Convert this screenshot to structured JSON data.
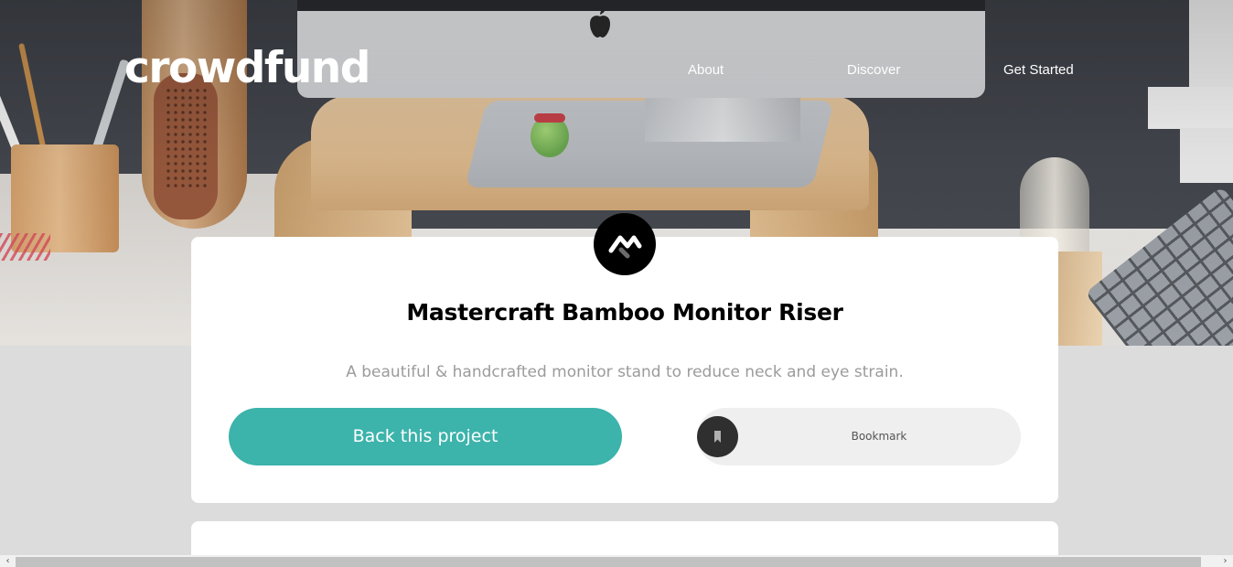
{
  "header": {
    "logo": "crowdfund",
    "nav": [
      {
        "label": "About"
      },
      {
        "label": "Discover"
      },
      {
        "label": "Get Started"
      }
    ]
  },
  "project": {
    "title": "Mastercraft Bamboo Monitor Riser",
    "description": "A beautiful & handcrafted monitor stand to reduce neck and eye strain.",
    "back_label": "Back this project",
    "bookmark_label": "Bookmark"
  },
  "scrollbar": {
    "left_arrow": "‹",
    "right_arrow": "›"
  },
  "icons": {
    "project_logo": "mastercraft-logo-icon",
    "bookmark": "bookmark-icon",
    "apple": "apple-logo-icon"
  },
  "colors": {
    "accent": "#3cb3ab",
    "page_background": "#dcdcdc",
    "card": "#ffffff",
    "title_text": "#000000",
    "muted_text": "#9b9b9b",
    "bookmark_bg": "#efefef",
    "bookmark_circle": "#2f2f2f"
  }
}
